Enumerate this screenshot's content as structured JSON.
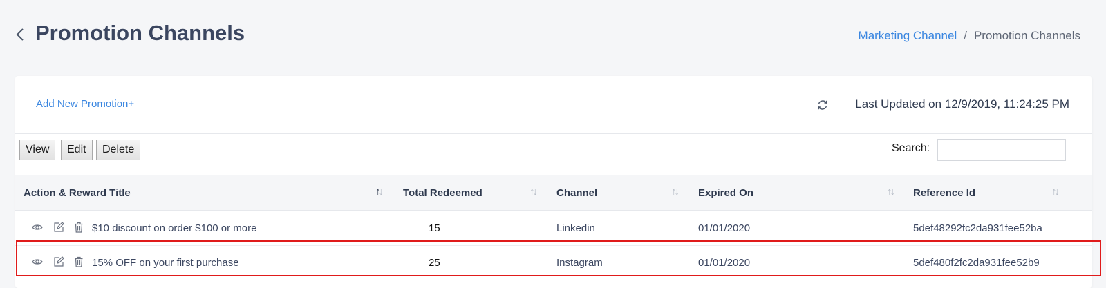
{
  "header": {
    "title": "Promotion Channels",
    "breadcrumb": [
      {
        "label": "Marketing Channel",
        "link": true
      },
      {
        "label": "Promotion Channels",
        "link": false
      }
    ],
    "separator": "/"
  },
  "toolbar": {
    "add_label": "Add New Promotion+",
    "last_updated": "Last Updated on 12/9/2019, 11:24:25 PM",
    "view_label": "View",
    "edit_label": "Edit",
    "delete_label": "Delete",
    "search_label": "Search:",
    "search_value": ""
  },
  "table": {
    "columns": [
      "Action & Reward Title",
      "Total Redeemed",
      "Channel",
      "Expired On",
      "Reference Id"
    ],
    "rows": [
      {
        "title": "$10 discount on order $100 or more",
        "redeemed": "15",
        "channel": "Linkedin",
        "expired": "01/01/2020",
        "ref": "5def48292fc2da931fee52ba"
      },
      {
        "title": "15% OFF on your first purchase",
        "redeemed": "25",
        "channel": "Instagram",
        "expired": "01/01/2020",
        "ref": "5def480f2fc2da931fee52b9"
      }
    ]
  },
  "colors": {
    "accent": "#3a86e0",
    "highlight": "#e01b1b"
  }
}
